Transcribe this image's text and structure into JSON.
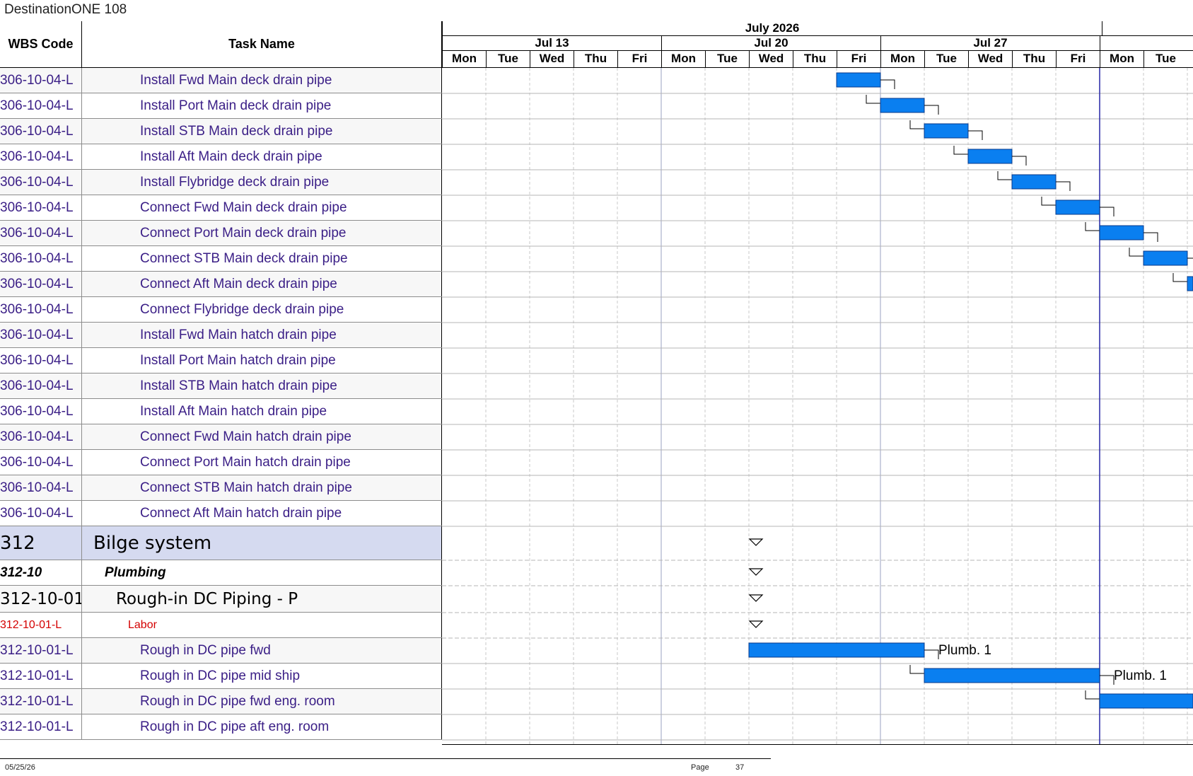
{
  "document_title": "DestinationONE 108",
  "columns": {
    "wbs": "WBS Code",
    "task": "Task Name"
  },
  "timescale": {
    "month": "July 2026",
    "weeks": [
      "Jul 13",
      "Jul 20",
      "Jul 27"
    ],
    "days": [
      "Mon",
      "Tue",
      "Wed",
      "Thu",
      "Fri",
      "Mon",
      "Tue",
      "Wed",
      "Thu",
      "Fri",
      "Mon",
      "Tue",
      "Wed",
      "Thu",
      "Fri",
      "Mon",
      "Tue"
    ]
  },
  "rows": [
    {
      "wbs": "306-10-04-L",
      "task": "Install Fwd Main deck drain pipe",
      "style": "task",
      "bar": {
        "start": 9,
        "end": 10
      }
    },
    {
      "wbs": "306-10-04-L",
      "task": "Install Port Main deck drain pipe",
      "style": "task",
      "bar": {
        "start": 10,
        "end": 11
      }
    },
    {
      "wbs": "306-10-04-L",
      "task": "Install STB Main deck drain pipe",
      "style": "task",
      "bar": {
        "start": 11,
        "end": 12
      }
    },
    {
      "wbs": "306-10-04-L",
      "task": "Install Aft Main deck drain pipe",
      "style": "task",
      "bar": {
        "start": 12,
        "end": 13
      }
    },
    {
      "wbs": "306-10-04-L",
      "task": "Install Flybridge deck drain pipe",
      "style": "task",
      "bar": {
        "start": 13,
        "end": 14
      }
    },
    {
      "wbs": "306-10-04-L",
      "task": "Connect Fwd Main deck drain pipe",
      "style": "task",
      "bar": {
        "start": 14,
        "end": 15
      }
    },
    {
      "wbs": "306-10-04-L",
      "task": "Connect Port Main deck drain pipe",
      "style": "task",
      "bar": {
        "start": 15,
        "end": 16
      }
    },
    {
      "wbs": "306-10-04-L",
      "task": "Connect STB Main deck drain pipe",
      "style": "task",
      "bar": {
        "start": 16,
        "end": 17
      }
    },
    {
      "wbs": "306-10-04-L",
      "task": "Connect Aft Main deck drain pipe",
      "style": "task",
      "bar": {
        "start": 17,
        "end": 18
      }
    },
    {
      "wbs": "306-10-04-L",
      "task": "Connect Flybridge deck drain pipe",
      "style": "task"
    },
    {
      "wbs": "306-10-04-L",
      "task": "Install Fwd Main hatch drain pipe",
      "style": "task"
    },
    {
      "wbs": "306-10-04-L",
      "task": "Install Port Main hatch drain pipe",
      "style": "task"
    },
    {
      "wbs": "306-10-04-L",
      "task": "Install STB Main hatch drain pipe",
      "style": "task"
    },
    {
      "wbs": "306-10-04-L",
      "task": "Install Aft Main hatch drain pipe",
      "style": "task"
    },
    {
      "wbs": "306-10-04-L",
      "task": "Connect Fwd Main hatch drain pipe",
      "style": "task"
    },
    {
      "wbs": "306-10-04-L",
      "task": "Connect Port Main hatch drain pipe",
      "style": "task"
    },
    {
      "wbs": "306-10-04-L",
      "task": "Connect STB Main hatch drain pipe",
      "style": "task"
    },
    {
      "wbs": "306-10-04-L",
      "task": "Connect Aft Main hatch drain pipe",
      "style": "task"
    },
    {
      "wbs": "312",
      "task": "Bilge system",
      "style": "system",
      "summary": 7
    },
    {
      "wbs": "312-10",
      "task": "Plumbing",
      "style": "group",
      "summary": 7
    },
    {
      "wbs": "312-10-01",
      "task": "Rough-in DC Piping - P",
      "style": "sub",
      "summary": 7
    },
    {
      "wbs": "312-10-01-L",
      "task": "Labor",
      "style": "labor",
      "summary": 7
    },
    {
      "wbs": "312-10-01-L",
      "task": "Rough in DC pipe fwd",
      "style": "task",
      "bar": {
        "start": 7,
        "end": 11
      },
      "resource": "Plumb. 1"
    },
    {
      "wbs": "312-10-01-L",
      "task": "Rough in DC pipe mid ship",
      "style": "task",
      "bar": {
        "start": 11,
        "end": 15
      },
      "resource": "Plumb. 1"
    },
    {
      "wbs": "312-10-01-L",
      "task": "Rough in DC pipe fwd eng. room",
      "style": "task",
      "bar": {
        "start": 15,
        "end": 19
      }
    },
    {
      "wbs": "312-10-01-L",
      "task": "Rough in DC pipe aft eng. room",
      "style": "task"
    }
  ],
  "footer": {
    "date": "05/25/26",
    "page_label": "Page",
    "page_number": "37"
  },
  "colors": {
    "bar": "#0a7ff0",
    "task_text": "#3a1e86",
    "labor_text": "#d40000",
    "system_bg": "#d5daf0",
    "alt_bg": "#f2f2f2",
    "today": "#2626a6"
  }
}
